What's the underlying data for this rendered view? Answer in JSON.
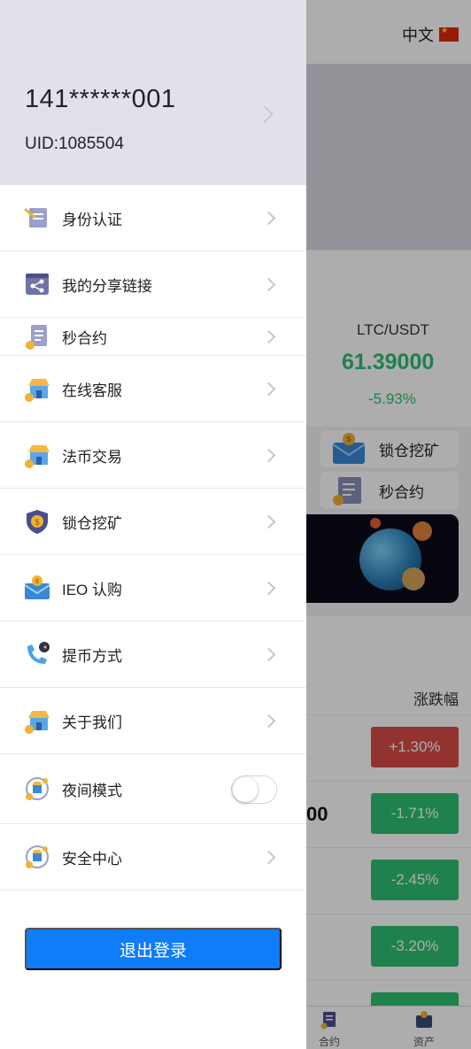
{
  "background": {
    "language_label": "中文",
    "ticker": {
      "pair": "LTC/USDT",
      "price": "61.39000",
      "change": "-5.93%"
    },
    "quick_menu": [
      {
        "label": "锁仓挖矿",
        "icon": "envelope-coin-icon"
      },
      {
        "label": "秒合约",
        "icon": "contract-doc-icon"
      }
    ],
    "market": {
      "column_header": "涨跌幅",
      "rows": [
        {
          "price": "",
          "change": "+1.30%",
          "color": "#d94c47"
        },
        {
          "price": "00",
          "change": "-1.71%",
          "color": "#2fbf71"
        },
        {
          "price": "",
          "change": "-2.45%",
          "color": "#2fbf71"
        },
        {
          "price": "",
          "change": "-3.20%",
          "color": "#2fbf71"
        },
        {
          "price": "",
          "change": "",
          "color": "#2fbf71"
        }
      ]
    },
    "tabbar": [
      {
        "label": "合约",
        "icon": "contract-tab-icon"
      },
      {
        "label": "资产",
        "icon": "wallet-tab-icon"
      }
    ]
  },
  "drawer": {
    "phone": "141******001",
    "uid": "UID:1085504",
    "menu": [
      {
        "label": "身份认证",
        "icon": "id-verify-icon"
      },
      {
        "label": "我的分享链接",
        "icon": "share-link-icon"
      },
      {
        "label": "秒合约",
        "icon": "contract-doc-icon"
      },
      {
        "label": "在线客服",
        "icon": "shop-coin-icon"
      },
      {
        "label": "法币交易",
        "icon": "shop-coin-icon"
      },
      {
        "label": "锁仓挖矿",
        "icon": "shield-coin-icon"
      },
      {
        "label": "IEO 认购",
        "icon": "envelope-coin-icon"
      },
      {
        "label": "提币方式",
        "icon": "phone-chat-icon"
      },
      {
        "label": "关于我们",
        "icon": "shop-coin-icon"
      },
      {
        "label": "夜间模式",
        "icon": "night-mode-icon",
        "toggle": false
      },
      {
        "label": "安全中心",
        "icon": "safe-center-icon"
      }
    ],
    "logout_label": "退出登录"
  },
  "colors": {
    "accent": "#0f7cf9",
    "up": "#d94c47",
    "down": "#2fbf71",
    "profile_bg": "#e1e1ec"
  }
}
